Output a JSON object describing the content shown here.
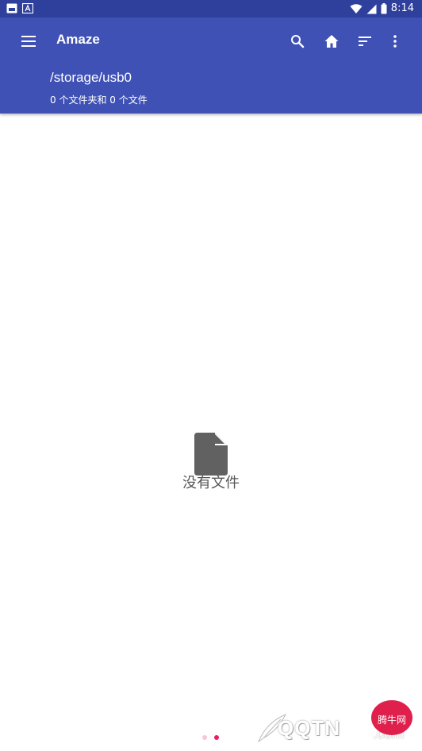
{
  "status_bar": {
    "time": "8:14"
  },
  "app_bar": {
    "title": "Amaze",
    "path": "/storage/usb0",
    "summary": "0 个文件夹和 0 个文件"
  },
  "empty_state": {
    "message": "没有文件"
  },
  "pager": {
    "active_index": 1,
    "count": 2
  },
  "watermark": {
    "text": "QQTN",
    "suffix": ".com",
    "badge": "腾牛网"
  },
  "colors": {
    "primary": "#3f51b5",
    "status_bar": "#2f3f9c",
    "accent": "#e91e63",
    "empty_icon": "#616161"
  }
}
